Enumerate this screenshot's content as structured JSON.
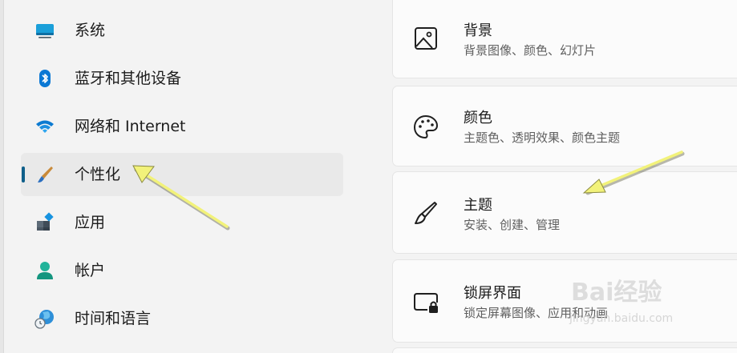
{
  "sidebar": {
    "items": [
      {
        "label": "系统",
        "icon": "system-monitor-icon"
      },
      {
        "label": "蓝牙和其他设备",
        "icon": "bluetooth-icon"
      },
      {
        "label": "网络和 Internet",
        "icon": "wifi-icon"
      },
      {
        "label": "个性化",
        "icon": "paintbrush-icon",
        "selected": true
      },
      {
        "label": "应用",
        "icon": "apps-icon"
      },
      {
        "label": "帐户",
        "icon": "account-icon"
      },
      {
        "label": "时间和语言",
        "icon": "time-language-icon"
      }
    ]
  },
  "cards": [
    {
      "title": "背景",
      "subtitle": "背景图像、颜色、幻灯片",
      "icon": "image-icon"
    },
    {
      "title": "颜色",
      "subtitle": "主题色、透明效果、颜色主题",
      "icon": "palette-icon"
    },
    {
      "title": "主题",
      "subtitle": "安装、创建、管理",
      "icon": "brush-icon"
    },
    {
      "title": "锁屏界面",
      "subtitle": "锁定屏幕图像、应用和动画",
      "icon": "lock-screen-icon"
    }
  ],
  "watermark": {
    "brand": "Bai经验",
    "url": "jingyan.baidu.com"
  },
  "colors": {
    "accent": "#0f5f8a",
    "annotation_arrow": "#f2f27a",
    "selected_bg": "#e9e9e9",
    "card_bg": "#fbfbfb"
  }
}
